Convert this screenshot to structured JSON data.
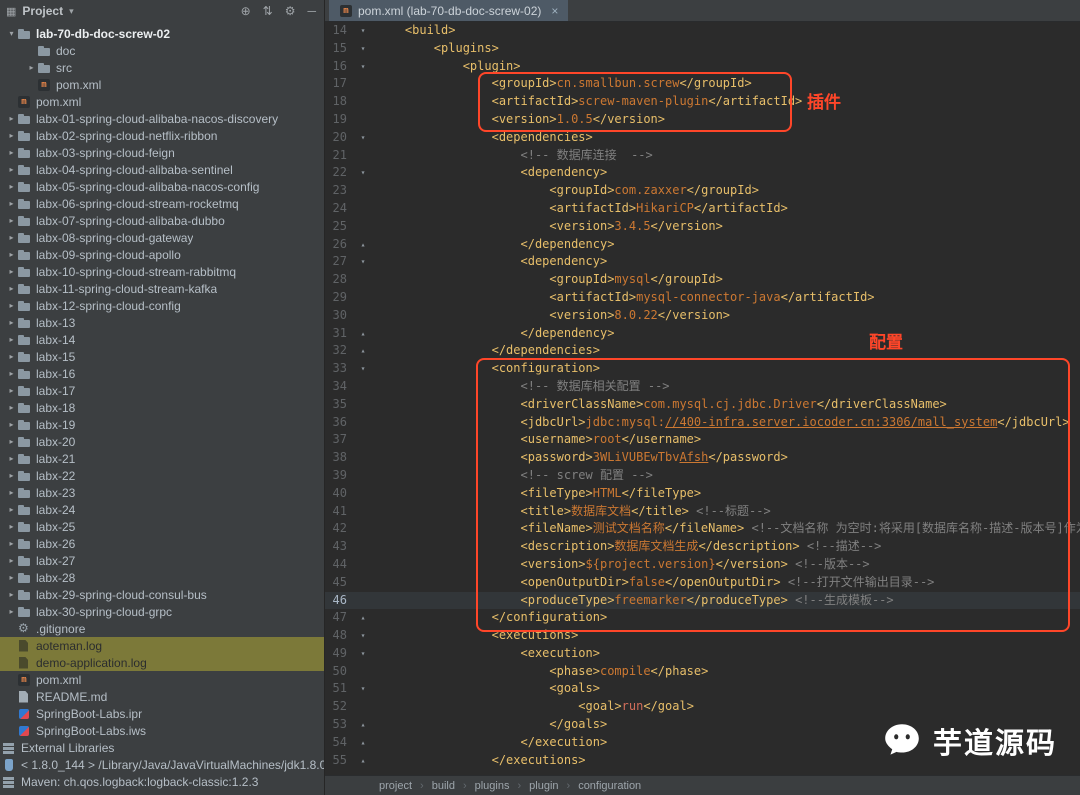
{
  "panel": {
    "title": "Project"
  },
  "tabs": {
    "active_label": "pom.xml (lab-70-db-doc-screw-02)"
  },
  "tree": {
    "items": [
      {
        "label": "lab-70-db-doc-screw-02",
        "level": 0,
        "arrow": "open",
        "icon": "folder",
        "bold": true
      },
      {
        "label": "doc",
        "level": 1,
        "icon": "folder"
      },
      {
        "label": "src",
        "level": 1,
        "arrow": "closed",
        "icon": "folder"
      },
      {
        "label": "pom.xml",
        "level": 1,
        "icon": "maven"
      },
      {
        "label": "pom.xml",
        "level": 0,
        "icon": "maven"
      },
      {
        "label": "labx-01-spring-cloud-alibaba-nacos-discovery",
        "level": 0,
        "arrow": "closed",
        "icon": "folder"
      },
      {
        "label": "labx-02-spring-cloud-netflix-ribbon",
        "level": 0,
        "arrow": "closed",
        "icon": "folder"
      },
      {
        "label": "labx-03-spring-cloud-feign",
        "level": 0,
        "arrow": "closed",
        "icon": "folder"
      },
      {
        "label": "labx-04-spring-cloud-alibaba-sentinel",
        "level": 0,
        "arrow": "closed",
        "icon": "folder"
      },
      {
        "label": "labx-05-spring-cloud-alibaba-nacos-config",
        "level": 0,
        "arrow": "closed",
        "icon": "folder"
      },
      {
        "label": "labx-06-spring-cloud-stream-rocketmq",
        "level": 0,
        "arrow": "closed",
        "icon": "folder"
      },
      {
        "label": "labx-07-spring-cloud-alibaba-dubbo",
        "level": 0,
        "arrow": "closed",
        "icon": "folder"
      },
      {
        "label": "labx-08-spring-cloud-gateway",
        "level": 0,
        "arrow": "closed",
        "icon": "folder"
      },
      {
        "label": "labx-09-spring-cloud-apollo",
        "level": 0,
        "arrow": "closed",
        "icon": "folder"
      },
      {
        "label": "labx-10-spring-cloud-stream-rabbitmq",
        "level": 0,
        "arrow": "closed",
        "icon": "folder"
      },
      {
        "label": "labx-11-spring-cloud-stream-kafka",
        "level": 0,
        "arrow": "closed",
        "icon": "folder"
      },
      {
        "label": "labx-12-spring-cloud-config",
        "level": 0,
        "arrow": "closed",
        "icon": "folder"
      },
      {
        "label": "labx-13",
        "level": 0,
        "arrow": "closed",
        "icon": "folder"
      },
      {
        "label": "labx-14",
        "level": 0,
        "arrow": "closed",
        "icon": "folder"
      },
      {
        "label": "labx-15",
        "level": 0,
        "arrow": "closed",
        "icon": "folder"
      },
      {
        "label": "labx-16",
        "level": 0,
        "arrow": "closed",
        "icon": "folder"
      },
      {
        "label": "labx-17",
        "level": 0,
        "arrow": "closed",
        "icon": "folder"
      },
      {
        "label": "labx-18",
        "level": 0,
        "arrow": "closed",
        "icon": "folder"
      },
      {
        "label": "labx-19",
        "level": 0,
        "arrow": "closed",
        "icon": "folder"
      },
      {
        "label": "labx-20",
        "level": 0,
        "arrow": "closed",
        "icon": "folder"
      },
      {
        "label": "labx-21",
        "level": 0,
        "arrow": "closed",
        "icon": "folder"
      },
      {
        "label": "labx-22",
        "level": 0,
        "arrow": "closed",
        "icon": "folder"
      },
      {
        "label": "labx-23",
        "level": 0,
        "arrow": "closed",
        "icon": "folder"
      },
      {
        "label": "labx-24",
        "level": 0,
        "arrow": "closed",
        "icon": "folder"
      },
      {
        "label": "labx-25",
        "level": 0,
        "arrow": "closed",
        "icon": "folder"
      },
      {
        "label": "labx-26",
        "level": 0,
        "arrow": "closed",
        "icon": "folder"
      },
      {
        "label": "labx-27",
        "level": 0,
        "arrow": "closed",
        "icon": "folder"
      },
      {
        "label": "labx-28",
        "level": 0,
        "arrow": "closed",
        "icon": "folder"
      },
      {
        "label": "labx-29-spring-cloud-consul-bus",
        "level": 0,
        "arrow": "closed",
        "icon": "folder"
      },
      {
        "label": "labx-30-spring-cloud-grpc",
        "level": 0,
        "arrow": "closed",
        "icon": "folder"
      },
      {
        "label": ".gitignore",
        "level": 0,
        "icon": "gear"
      },
      {
        "label": "aoteman.log",
        "level": 0,
        "icon": "file",
        "style": "log"
      },
      {
        "label": "demo-application.log",
        "level": 0,
        "icon": "file",
        "style": "log"
      },
      {
        "label": "pom.xml",
        "level": 0,
        "icon": "maven"
      },
      {
        "label": "README.md",
        "level": 0,
        "icon": "file"
      },
      {
        "label": "SpringBoot-Labs.ipr",
        "level": 0,
        "icon": "idea"
      },
      {
        "label": "SpringBoot-Labs.iws",
        "level": 0,
        "icon": "idea"
      },
      {
        "label": "External Libraries",
        "level": 0,
        "icon": "lib",
        "flush": true
      },
      {
        "label": "< 1.8.0_144 > /Library/Java/JavaVirtualMachines/jdk1.8.0_1",
        "level": 0,
        "icon": "jdk",
        "flush": true
      },
      {
        "label": "Maven: ch.qos.logback:logback-classic:1.2.3",
        "level": 0,
        "icon": "lib",
        "flush": true
      }
    ]
  },
  "editor": {
    "current_line": 46,
    "lines": [
      {
        "n": 14,
        "f": "s",
        "s": [
          [
            "p",
            "    "
          ],
          [
            "t",
            "<build>"
          ]
        ]
      },
      {
        "n": 15,
        "f": "s",
        "s": [
          [
            "p",
            "        "
          ],
          [
            "t",
            "<plugins>"
          ]
        ]
      },
      {
        "n": 16,
        "f": "s",
        "s": [
          [
            "p",
            "            "
          ],
          [
            "t",
            "<plugin>"
          ]
        ]
      },
      {
        "n": 17,
        "s": [
          [
            "p",
            "                "
          ],
          [
            "t",
            "<groupId>"
          ],
          [
            "x",
            "cn.smallbun.screw"
          ],
          [
            "t",
            "</groupId>"
          ]
        ]
      },
      {
        "n": 18,
        "s": [
          [
            "p",
            "                "
          ],
          [
            "t",
            "<artifactId>"
          ],
          [
            "x",
            "screw-maven-plugin"
          ],
          [
            "t",
            "</artifactId>"
          ]
        ]
      },
      {
        "n": 19,
        "s": [
          [
            "p",
            "                "
          ],
          [
            "t",
            "<version>"
          ],
          [
            "x",
            "1.0.5"
          ],
          [
            "t",
            "</version>"
          ]
        ]
      },
      {
        "n": 20,
        "f": "s",
        "s": [
          [
            "p",
            "                "
          ],
          [
            "t",
            "<dependencies>"
          ]
        ]
      },
      {
        "n": 21,
        "s": [
          [
            "p",
            "                    "
          ],
          [
            "c",
            "<!-- 数据库连接  -->"
          ]
        ]
      },
      {
        "n": 22,
        "f": "s",
        "s": [
          [
            "p",
            "                    "
          ],
          [
            "t",
            "<dependency>"
          ]
        ]
      },
      {
        "n": 23,
        "s": [
          [
            "p",
            "                        "
          ],
          [
            "t",
            "<groupId>"
          ],
          [
            "x",
            "com.zaxxer"
          ],
          [
            "t",
            "</groupId>"
          ]
        ]
      },
      {
        "n": 24,
        "s": [
          [
            "p",
            "                        "
          ],
          [
            "t",
            "<artifactId>"
          ],
          [
            "x",
            "HikariCP"
          ],
          [
            "t",
            "</artifactId>"
          ]
        ]
      },
      {
        "n": 25,
        "s": [
          [
            "p",
            "                        "
          ],
          [
            "t",
            "<version>"
          ],
          [
            "x",
            "3.4.5"
          ],
          [
            "t",
            "</version>"
          ]
        ]
      },
      {
        "n": 26,
        "f": "e",
        "s": [
          [
            "p",
            "                    "
          ],
          [
            "t",
            "</dependency>"
          ]
        ]
      },
      {
        "n": 27,
        "f": "s",
        "s": [
          [
            "p",
            "                    "
          ],
          [
            "t",
            "<dependency>"
          ]
        ]
      },
      {
        "n": 28,
        "s": [
          [
            "p",
            "                        "
          ],
          [
            "t",
            "<groupId>"
          ],
          [
            "x",
            "mysql"
          ],
          [
            "t",
            "</groupId>"
          ]
        ]
      },
      {
        "n": 29,
        "s": [
          [
            "p",
            "                        "
          ],
          [
            "t",
            "<artifactId>"
          ],
          [
            "x",
            "mysql-connector-java"
          ],
          [
            "t",
            "</artifactId>"
          ]
        ]
      },
      {
        "n": 30,
        "s": [
          [
            "p",
            "                        "
          ],
          [
            "t",
            "<version>"
          ],
          [
            "x",
            "8.0.22"
          ],
          [
            "t",
            "</version>"
          ]
        ]
      },
      {
        "n": 31,
        "f": "e",
        "s": [
          [
            "p",
            "                    "
          ],
          [
            "t",
            "</dependency>"
          ]
        ]
      },
      {
        "n": 32,
        "f": "e",
        "s": [
          [
            "p",
            "                "
          ],
          [
            "t",
            "</dependencies>"
          ]
        ]
      },
      {
        "n": 33,
        "f": "s",
        "s": [
          [
            "p",
            "                "
          ],
          [
            "t",
            "<configuration>"
          ]
        ]
      },
      {
        "n": 34,
        "s": [
          [
            "p",
            "                    "
          ],
          [
            "c",
            "<!-- 数据库相关配置 -->"
          ]
        ]
      },
      {
        "n": 35,
        "s": [
          [
            "p",
            "                    "
          ],
          [
            "t",
            "<driverClassName>"
          ],
          [
            "x",
            "com.mysql.cj.jdbc.Driver"
          ],
          [
            "t",
            "</driverClassName>"
          ]
        ]
      },
      {
        "n": 36,
        "s": [
          [
            "p",
            "                    "
          ],
          [
            "t",
            "<jdbcUrl>"
          ],
          [
            "x",
            "jdbc:mysql:"
          ],
          [
            "u",
            "//400-infra.server.iocoder.cn:3306/mall_system"
          ],
          [
            "t",
            "</jdbcUrl>"
          ]
        ]
      },
      {
        "n": 37,
        "s": [
          [
            "p",
            "                    "
          ],
          [
            "t",
            "<username>"
          ],
          [
            "x",
            "root"
          ],
          [
            "t",
            "</username>"
          ]
        ]
      },
      {
        "n": 38,
        "s": [
          [
            "p",
            "                    "
          ],
          [
            "t",
            "<password>"
          ],
          [
            "x",
            "3WLiVUBEwTbv"
          ],
          [
            "u",
            "Afsh"
          ],
          [
            "t",
            "</password>"
          ]
        ]
      },
      {
        "n": 39,
        "s": [
          [
            "p",
            "                    "
          ],
          [
            "c",
            "<!-- screw 配置 -->"
          ]
        ]
      },
      {
        "n": 40,
        "s": [
          [
            "p",
            "                    "
          ],
          [
            "t",
            "<fileType>"
          ],
          [
            "x",
            "HTML"
          ],
          [
            "t",
            "</fileType>"
          ]
        ]
      },
      {
        "n": 41,
        "s": [
          [
            "p",
            "                    "
          ],
          [
            "t",
            "<title>"
          ],
          [
            "x",
            "数据库文档"
          ],
          [
            "t",
            "</title>"
          ],
          [
            "p",
            " "
          ],
          [
            "c",
            "<!--标题-->"
          ]
        ]
      },
      {
        "n": 42,
        "s": [
          [
            "p",
            "                    "
          ],
          [
            "t",
            "<fileName>"
          ],
          [
            "x",
            "测试文档名称"
          ],
          [
            "t",
            "</fileName>"
          ],
          [
            "p",
            " "
          ],
          [
            "c",
            "<!--文档名称 为空时:将采用[数据库名称-描述-版本号]作为文档名称"
          ]
        ]
      },
      {
        "n": 43,
        "s": [
          [
            "p",
            "                    "
          ],
          [
            "t",
            "<description>"
          ],
          [
            "x",
            "数据库文档生成"
          ],
          [
            "t",
            "</description>"
          ],
          [
            "p",
            " "
          ],
          [
            "c",
            "<!--描述-->"
          ]
        ]
      },
      {
        "n": 44,
        "s": [
          [
            "p",
            "                    "
          ],
          [
            "t",
            "<version>"
          ],
          [
            "x",
            "${project.version}"
          ],
          [
            "t",
            "</version>"
          ],
          [
            "p",
            " "
          ],
          [
            "c",
            "<!--版本-->"
          ]
        ]
      },
      {
        "n": 45,
        "s": [
          [
            "p",
            "                    "
          ],
          [
            "t",
            "<openOutputDir>"
          ],
          [
            "x",
            "false"
          ],
          [
            "t",
            "</openOutputDir>"
          ],
          [
            "p",
            " "
          ],
          [
            "c",
            "<!--打开文件输出目录-->"
          ]
        ]
      },
      {
        "n": 46,
        "s": [
          [
            "p",
            "                    "
          ],
          [
            "t",
            "<produceType>"
          ],
          [
            "x",
            "freemarker"
          ],
          [
            "t",
            "</produceType>"
          ],
          [
            "p",
            " "
          ],
          [
            "c",
            "<!--生成模板-->"
          ]
        ]
      },
      {
        "n": 47,
        "f": "e",
        "s": [
          [
            "p",
            "                "
          ],
          [
            "t",
            "</configuration>"
          ]
        ]
      },
      {
        "n": 48,
        "f": "s",
        "s": [
          [
            "p",
            "                "
          ],
          [
            "t",
            "<executions>"
          ]
        ]
      },
      {
        "n": 49,
        "f": "s",
        "s": [
          [
            "p",
            "                    "
          ],
          [
            "t",
            "<execution>"
          ]
        ]
      },
      {
        "n": 50,
        "s": [
          [
            "p",
            "                        "
          ],
          [
            "t",
            "<phase>"
          ],
          [
            "x",
            "compile"
          ],
          [
            "t",
            "</phase>"
          ]
        ]
      },
      {
        "n": 51,
        "f": "s",
        "s": [
          [
            "p",
            "                        "
          ],
          [
            "t",
            "<goals>"
          ]
        ]
      },
      {
        "n": 52,
        "s": [
          [
            "p",
            "                            "
          ],
          [
            "t",
            "<goal>"
          ],
          [
            "g",
            "run"
          ],
          [
            "t",
            "</goal>"
          ]
        ]
      },
      {
        "n": 53,
        "f": "e",
        "s": [
          [
            "p",
            "                        "
          ],
          [
            "t",
            "</goals>"
          ]
        ]
      },
      {
        "n": 54,
        "f": "e",
        "s": [
          [
            "p",
            "                    "
          ],
          [
            "t",
            "</execution>"
          ]
        ]
      },
      {
        "n": 55,
        "f": "e",
        "s": [
          [
            "p",
            "                "
          ],
          [
            "t",
            "</executions>"
          ]
        ]
      }
    ]
  },
  "annotations": {
    "plugin": "插件",
    "config": "配置",
    "color": "#ff4629"
  },
  "breadcrumbs": [
    "project",
    "build",
    "plugins",
    "plugin",
    "configuration"
  ],
  "watermark": {
    "text": "芋道源码"
  },
  "colors": {
    "tag": "#e8bf6a",
    "value": "#cc7832",
    "comment": "#808080",
    "accent_red": "#ff4629",
    "panel_bg": "#3c3f41",
    "editor_bg": "#2b2b2b",
    "log_highlight": "#7c7939"
  }
}
